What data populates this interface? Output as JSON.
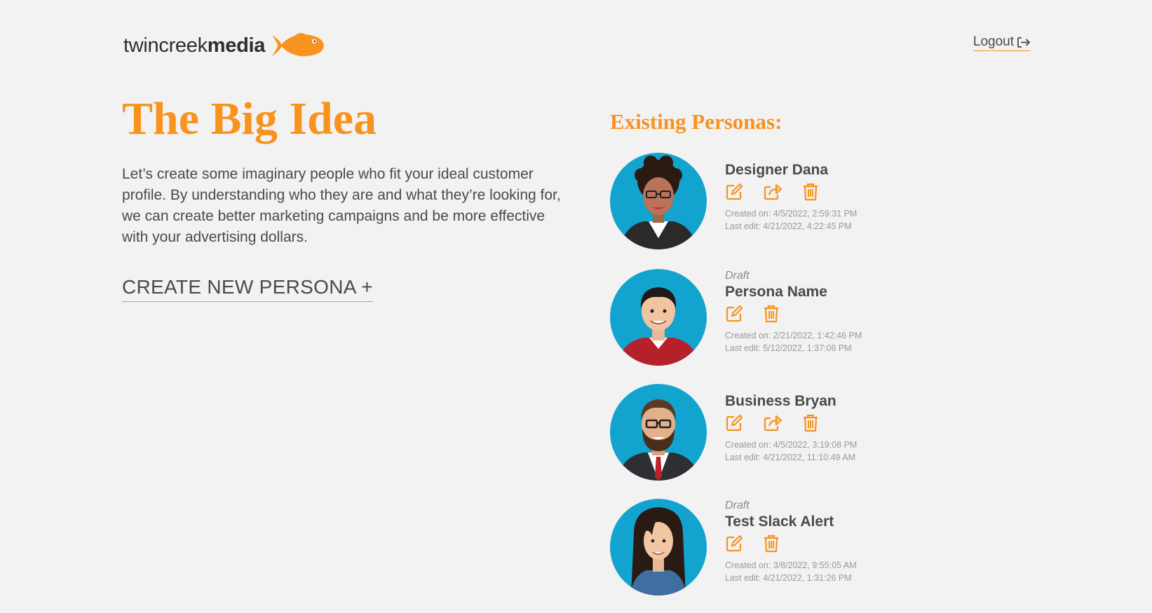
{
  "header": {
    "logo_text_light": "twincreek",
    "logo_text_bold": "media",
    "logout_label": "Logout"
  },
  "main": {
    "title": "The Big Idea",
    "intro": "Let’s create some imaginary people who fit your ideal customer profile. By understanding who they are and what they’re looking for, we can create better marketing campaigns and be more effective with your advertising dollars.",
    "create_label": "CREATE NEW PERSONA +"
  },
  "personas_section": {
    "title": "Existing Personas:",
    "items": [
      {
        "draft": "",
        "name": "Designer Dana",
        "created": "Created on: 4/5/2022, 2:59:31 PM",
        "edited": "Last edit: 4/21/2022, 4:22:45 PM",
        "actions": [
          "edit-icon",
          "share-icon",
          "trash-icon"
        ]
      },
      {
        "draft": "Draft",
        "name": "Persona Name",
        "created": "Created on: 2/21/2022, 1:42:46 PM",
        "edited": "Last edit: 5/12/2022, 1:37:06 PM",
        "actions": [
          "edit-icon",
          "trash-icon"
        ]
      },
      {
        "draft": "",
        "name": "Business Bryan",
        "created": "Created on: 4/5/2022, 3:19:08 PM",
        "edited": "Last edit: 4/21/2022, 11:10:49 AM",
        "actions": [
          "edit-icon",
          "share-icon",
          "trash-icon"
        ]
      },
      {
        "draft": "Draft",
        "name": "Test Slack Alert",
        "created": "Created on: 3/8/2022, 9:55:05 AM",
        "edited": "Last edit: 4/21/2022, 1:31:26 PM",
        "actions": [
          "edit-icon",
          "trash-icon"
        ]
      }
    ]
  },
  "colors": {
    "accent": "#f7931e",
    "avatar_bg": "#12a3cf",
    "background": "#f2f2f2",
    "text": "#4a4a4a"
  }
}
